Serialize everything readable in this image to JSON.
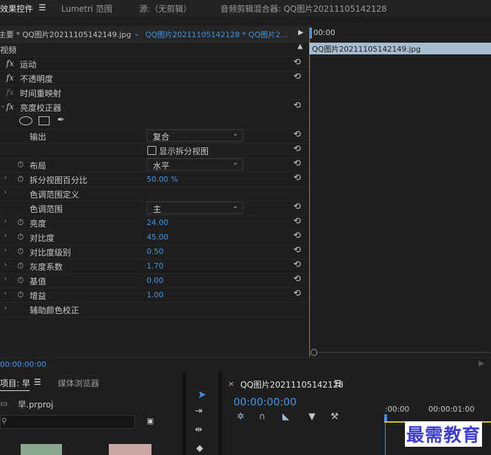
{
  "tabs": [
    {
      "label": "效果控件",
      "active": true
    },
    {
      "label": "Lumetri 范围",
      "active": false
    },
    {
      "label": "源:（无剪辑）",
      "active": false
    },
    {
      "label": "音频剪辑混合器: QQ图片20211105142128",
      "active": false
    }
  ],
  "ec_header": {
    "master_clip": "主要 * QQ图片20211105142149.jpg",
    "seq_clip": "QQ图片20211105142128 * QQ图片2...",
    "timecode_start": "00:00",
    "clip_bar_name": "QQ图片20211105142149.jpg"
  },
  "section_video": "视频",
  "effects": {
    "motion": "运动",
    "opacity": "不透明度",
    "time_remap": "时间重映射",
    "brightness_corrector": "亮度校正器",
    "fx": "fx"
  },
  "params": {
    "output_label": "输出",
    "output_value": "复合",
    "split_view_label": "显示拆分视图",
    "layout_label": "布局",
    "layout_value": "水平",
    "split_percent_label": "拆分视图百分比",
    "split_percent_value": "50.00 %",
    "tonal_range_def": "色调范围定义",
    "tonal_range_label": "色调范围",
    "tonal_range_value": "主",
    "brightness_label": "亮度",
    "brightness_value": "24.00",
    "contrast_label": "对比度",
    "contrast_value": "45.00",
    "contrast_level_label": "对比度级别",
    "contrast_level_value": "0.50",
    "gamma_label": "灰度系数",
    "gamma_value": "1.70",
    "pedestal_label": "基值",
    "pedestal_value": "0.00",
    "gain_label": "增益",
    "gain_value": "1.00",
    "secondary_label": "辅助颜色校正"
  },
  "ec_footer_timecode": "00:00:00:00",
  "project": {
    "tab": "项目: 早",
    "media_browser": "媒体浏览器",
    "file": "早.prproj"
  },
  "sequence": {
    "name": "QQ图片20211105142128",
    "timecode": "00:00:00:00",
    "ruler_start": ":00:00",
    "ruler_next": "00:00:01:00"
  },
  "watermark": "最需教育"
}
